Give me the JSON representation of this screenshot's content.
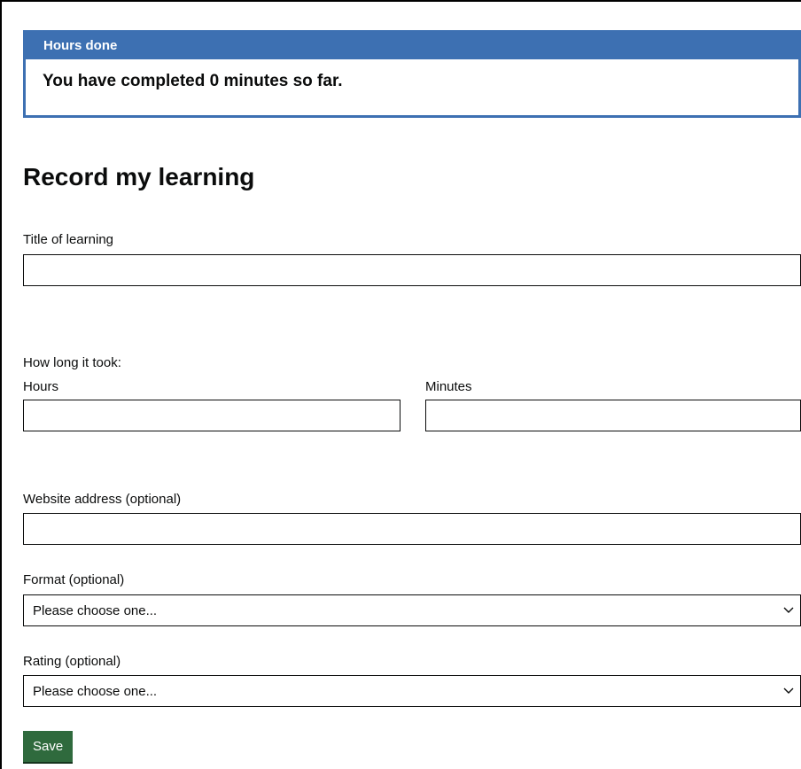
{
  "hours_done": {
    "header": "Hours done",
    "summary": "You have completed 0 minutes so far."
  },
  "form": {
    "title": "Record my learning",
    "title_of_learning": {
      "label": "Title of learning",
      "value": ""
    },
    "duration": {
      "question": "How long it took:",
      "hours": {
        "label": "Hours",
        "value": ""
      },
      "minutes": {
        "label": "Minutes",
        "value": ""
      }
    },
    "website": {
      "label": "Website address (optional)",
      "value": ""
    },
    "format": {
      "label": "Format (optional)",
      "selected": "Please choose one..."
    },
    "rating": {
      "label": "Rating (optional)",
      "selected": "Please choose one..."
    },
    "save_label": "Save"
  },
  "icons": {
    "select_arrow": "chevron-down-icon"
  },
  "colors": {
    "panel_blue": "#3d70b2",
    "save_green": "#2f6a3d"
  }
}
